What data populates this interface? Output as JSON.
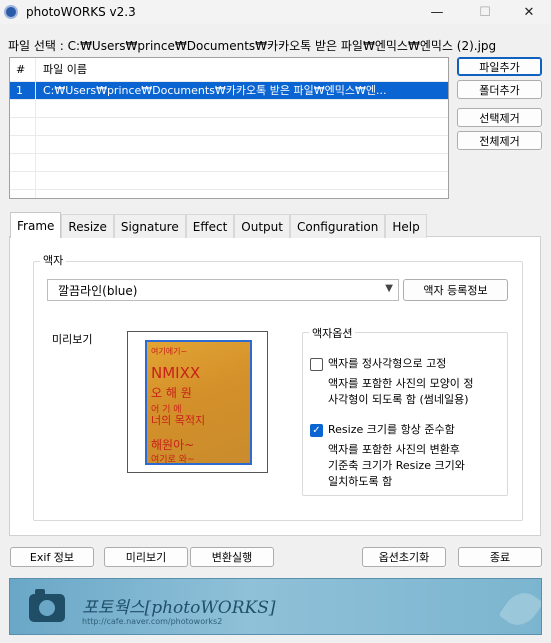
{
  "window": {
    "title": "photoWORKS v2.3",
    "minimize_glyph": "—",
    "maximize_glyph": "☐",
    "close_glyph": "✕"
  },
  "file_select": {
    "label": "파일 선택 : C:₩Users₩prince₩Documents₩카카오톡 받은 파일₩엔믹스₩엔믹스 (2).jpg"
  },
  "file_list": {
    "headers": [
      "#",
      "파일 이름"
    ],
    "rows": [
      {
        "num": "1",
        "name": "C:₩Users₩prince₩Documents₩카카오톡 받은 파일₩엔믹스₩엔..."
      }
    ]
  },
  "side_buttons": {
    "add_file": "파일추가",
    "add_folder": "폴더추가",
    "remove_selected": "선택제거",
    "remove_all": "전체제거"
  },
  "tabs": [
    "Frame",
    "Resize",
    "Signature",
    "Effect",
    "Output",
    "Configuration",
    "Help"
  ],
  "active_tab": "Frame",
  "frame": {
    "group_label": "액자",
    "selected_frame": "깔끔라인(blue)",
    "frame_info_button": "액자 등록정보",
    "preview_label": "미리보기",
    "options_label": "액자옵션",
    "option1": {
      "label": "액자를 정사각형으로 고정",
      "checked": false,
      "description": [
        "액자를 포함한 사진의 모양이 정",
        "사각형이 되도록 함 (썸네일용)"
      ]
    },
    "option2": {
      "label": "Resize 크기를 항상 준수함",
      "checked": true,
      "description": [
        "액자를 포함한 사진의 변환후",
        "기준축 크기가 Resize 크기와",
        "일치하도록 함"
      ]
    }
  },
  "bottom_buttons": {
    "exif": "Exif 정보",
    "preview": "미리보기",
    "convert": "변환실행",
    "reset_options": "옵션초기화",
    "exit": "종료"
  },
  "banner": {
    "brand": "포토웍스[photoWORKS]",
    "url": "http://cafe.naver.com/photoworks2"
  },
  "colors": {
    "selection": "#0a64d2",
    "accent": "#1060c0",
    "banner": "#7cb5cf"
  }
}
